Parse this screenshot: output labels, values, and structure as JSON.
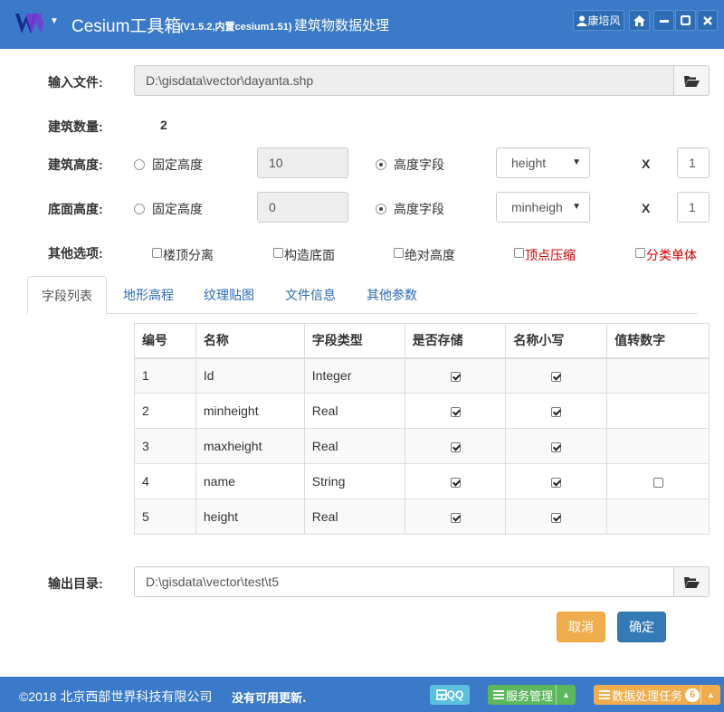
{
  "title": {
    "app": "Cesium工具箱",
    "version": "(V1.5.2,内置cesium1.51)",
    "subtitle": "建筑物数据处理",
    "user": "康培风"
  },
  "form": {
    "input_label": "输入文件:",
    "input_value": "D:\\gisdata\\vector\\dayanta.shp",
    "count_label": "建筑数量:",
    "count_value": "2",
    "height_label": "建筑高度:",
    "height_fixed": "固定高度",
    "height_fixed_value": "10",
    "height_field": "高度字段",
    "height_field_value": "height",
    "height_x": "X",
    "height_mult": "1",
    "base_label": "底面高度:",
    "base_fixed": "固定高度",
    "base_fixed_value": "0",
    "base_field": "高度字段",
    "base_field_value": "minheigh",
    "base_x": "X",
    "base_mult": "1",
    "options_label": "其他选项:",
    "options": [
      "楼顶分离",
      "构造底面",
      "绝对高度",
      "顶点压缩",
      "分类单体"
    ],
    "output_label": "输出目录:",
    "output_value": "D:\\gisdata\\vector\\test\\t5"
  },
  "tabs": [
    "字段列表",
    "地形高程",
    "纹理贴图",
    "文件信息",
    "其他参数"
  ],
  "table": {
    "headers": [
      "编号",
      "名称",
      "字段类型",
      "是否存储",
      "名称小写",
      "值转数字"
    ],
    "rows": [
      {
        "id": "1",
        "name": "Id",
        "type": "Integer",
        "store": true,
        "lower": true,
        "num": null
      },
      {
        "id": "2",
        "name": "minheight",
        "type": "Real",
        "store": true,
        "lower": true,
        "num": null
      },
      {
        "id": "3",
        "name": "maxheight",
        "type": "Real",
        "store": true,
        "lower": true,
        "num": null
      },
      {
        "id": "4",
        "name": "name",
        "type": "String",
        "store": true,
        "lower": true,
        "num": false
      },
      {
        "id": "5",
        "name": "height",
        "type": "Real",
        "store": true,
        "lower": true,
        "num": null
      }
    ]
  },
  "buttons": {
    "cancel": "取消",
    "ok": "确定"
  },
  "status": {
    "copyright": "©2018 北京西部世界科技有限公司",
    "update": "没有可用更新.",
    "qq": "QQ",
    "service": "服务管理",
    "task": "数据处理任务",
    "task_count": "6"
  },
  "colors": {
    "primary": "#3a7ac8",
    "warning": "#f0ad4e",
    "success": "#5cb85c",
    "info": "#5bc0de",
    "danger_text": "#cc0000"
  }
}
